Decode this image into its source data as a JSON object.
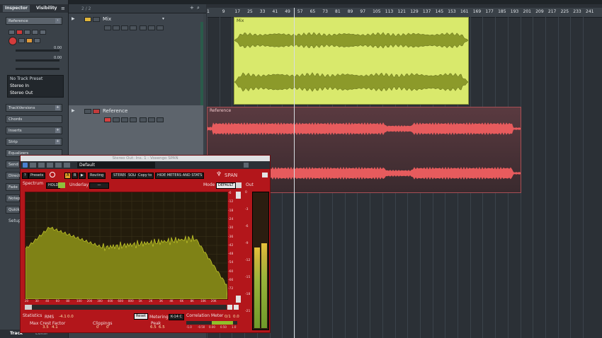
{
  "inspector": {
    "tabs": [
      "Inspector",
      "Visibility"
    ],
    "track_name": "Reference",
    "volume_value": "0.00",
    "pan_value": "0.00",
    "no_track_preset": "No Track Preset",
    "stereo_in": "Stereo In",
    "stereo_out": "Stereo Out",
    "sections": [
      "TrackVersions",
      "Chords",
      "Inserts",
      "Strip",
      "Equalizers",
      "Send",
      "Direct",
      "Fade",
      "Notep",
      "Quick",
      "Setup"
    ],
    "bottom_tabs": [
      "Track",
      "Editor"
    ]
  },
  "track_list": {
    "counter": "2 / 2",
    "tracks": [
      {
        "name": "Mix"
      },
      {
        "name": "Reference"
      }
    ]
  },
  "ruler": {
    "bars": [
      "1",
      "9",
      "17",
      "25",
      "33",
      "41",
      "49",
      "57",
      "65",
      "73",
      "81",
      "89",
      "97",
      "105",
      "113",
      "121",
      "129",
      "137",
      "145",
      "153",
      "161",
      "169",
      "177",
      "185",
      "193",
      "201",
      "209",
      "217",
      "225",
      "233",
      "241"
    ]
  },
  "events": {
    "mix": "Mix",
    "reference": "Reference"
  },
  "plugin": {
    "window_title": "Stereo Out: Ins. 1 - Voxengo SPAN",
    "preset_name": "Default",
    "buttons": {
      "presets": "Presets",
      "ab_a": "A",
      "ab_b": "B",
      "routing": "Routing",
      "stereo": "STEREO",
      "solo": "SOLO",
      "copy_to": "Copy to",
      "hide_meters": "HIDE METERS AND STATS"
    },
    "brand": "SPAN",
    "spectrum_label": "Spectrum",
    "hold": "HOLD",
    "underlay_label": "Underlay",
    "underlay_value": "—",
    "mode_label": "Mode",
    "mode_value": "DEFAULT",
    "out_label": "Out",
    "statistics_label": "Statistics",
    "rms_label": "RMS",
    "rms_values": [
      "-4.1",
      "0.0"
    ],
    "max_crest_label": "Max Crest Factor",
    "max_crest_values": [
      "3.5",
      "4.1"
    ],
    "clippings_label": "Clippings",
    "clippings_values": [
      "0",
      "0"
    ],
    "peak_label": "Peak",
    "peak_values": [
      "6.5",
      "6.5"
    ],
    "reset_label": "Reset",
    "metering_label": "Metering",
    "metering_value": "K-14 C",
    "correlation_label": "Correlation Meter",
    "correlation_values": [
      "0/1",
      "0.0"
    ],
    "corr_scale": [
      "-1.0",
      "-0.50",
      "0.00",
      "0.50",
      "1.0"
    ],
    "db_scale": [
      "-6",
      "-12",
      "-18",
      "-24",
      "-30",
      "-36",
      "-42",
      "-48",
      "-54",
      "-60",
      "-66",
      "-72"
    ],
    "freq_scale": [
      "20",
      "30",
      "40",
      "60",
      "80",
      "100",
      "200",
      "300",
      "400",
      "600",
      "800",
      "1K",
      "2K",
      "3K",
      "4K",
      "6K",
      "8K",
      "10K",
      "20K"
    ],
    "out_scale": [
      "0",
      "-3",
      "-6",
      "-9",
      "-12",
      "-15",
      "-18",
      "-21"
    ],
    "meter_levels": {
      "left": 0.6,
      "right": 0.63
    }
  },
  "colors": {
    "mix_event": "#d9e96c",
    "reference_wave": "#e75b5d",
    "plugin_bg": "#b3161b",
    "spectrum_fill": "#7f8216"
  }
}
